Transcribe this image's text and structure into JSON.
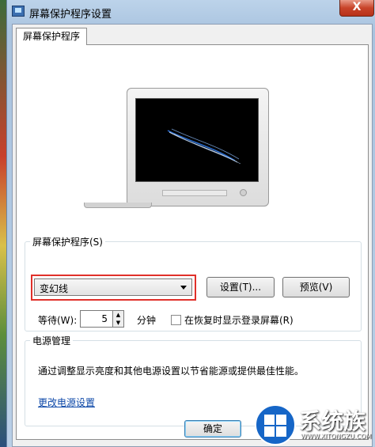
{
  "window": {
    "title": "屏幕保护程序设置",
    "close_symbol": "X"
  },
  "tabs": [
    {
      "label": "屏幕保护程序"
    }
  ],
  "screensaver": {
    "group_label": "屏幕保护程序(S)",
    "selected": "变幻线",
    "settings_button": "设置(T)...",
    "preview_button": "预览(V)",
    "wait_label": "等待(W):",
    "wait_value": "5",
    "wait_unit": "分钟",
    "resume_checkbox_label": "在恢复时显示登录屏幕(R)",
    "resume_checked": false
  },
  "power": {
    "group_label": "电源管理",
    "description": "通过调整显示亮度和其他电源设置以节省能源或提供最佳性能。",
    "link": "更改电源设置"
  },
  "footer": {
    "ok_button": "确定"
  },
  "watermark": {
    "brand": "系统族",
    "url": "WWW.XITONGZU.COM"
  },
  "colors": {
    "highlight_frame": "#e0302a",
    "link": "#0d48a8"
  }
}
